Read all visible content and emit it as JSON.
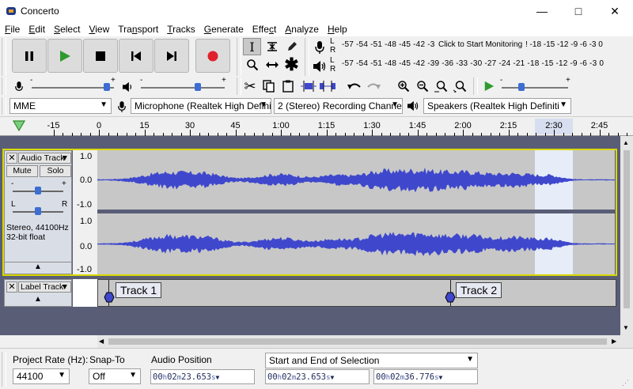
{
  "window": {
    "title": "Concerto"
  },
  "menu": [
    "File",
    "Edit",
    "Select",
    "View",
    "Transport",
    "Tracks",
    "Generate",
    "Effect",
    "Analyze",
    "Help"
  ],
  "menu_underline": [
    "F",
    "E",
    "S",
    "V",
    "n",
    "T",
    "G",
    "c",
    "A",
    "H"
  ],
  "meters": {
    "record_scale": "-57 -54 -51 -48 -45 -42 -3",
    "record_hint": "Click to Start Monitoring",
    "record_scale_right": "! -18 -15 -12  -9  -6  -3  0",
    "playback_scale": "-57 -54 -51 -48 -45 -42 -39 -36 -33 -30 -27 -24 -21 -18 -15 -12  -9  -6  -3  0",
    "lr_top": "L",
    "lr_bottom": "R"
  },
  "device": {
    "host": "MME",
    "input": "Microphone (Realtek High Defini",
    "channels": "2 (Stereo) Recording Channels",
    "output": "Speakers (Realtek High Definiti"
  },
  "ruler": {
    "labels": [
      "-15",
      "0",
      "15",
      "30",
      "45",
      "1:00",
      "1:15",
      "1:30",
      "1:45",
      "2:00",
      "2:15",
      "2:30",
      "2:45"
    ]
  },
  "audio_track": {
    "name": "Audio Track",
    "mute": "Mute",
    "solo": "Solo",
    "pan_l": "L",
    "pan_r": "R",
    "gain_minus": "-",
    "gain_plus": "+",
    "info_line1": "Stereo, 44100Hz",
    "info_line2": "32-bit float",
    "scale": [
      "1.0",
      "0.0",
      "-1.0",
      "1.0",
      "0.0",
      "-1.0"
    ]
  },
  "label_track": {
    "name": "Label Track",
    "labels": [
      "Track 1",
      "Track 2"
    ]
  },
  "bottom": {
    "project_rate_label": "Project Rate (Hz):",
    "project_rate": "44100",
    "snap_label": "Snap-To",
    "snap_value": "Off",
    "audio_pos_label": "Audio Position",
    "selection_label": "Start and End of Selection",
    "audio_pos": {
      "h": "00",
      "m": "02",
      "s": "23.653"
    },
    "sel_start": {
      "h": "00",
      "m": "02",
      "s": "23.653"
    },
    "sel_end": {
      "h": "00",
      "m": "02",
      "s": "36.776"
    }
  },
  "colors": {
    "wave": "#3f48cc",
    "selection": "#e6ecf8",
    "record": "#e0212b",
    "play": "#2e9a2e"
  }
}
